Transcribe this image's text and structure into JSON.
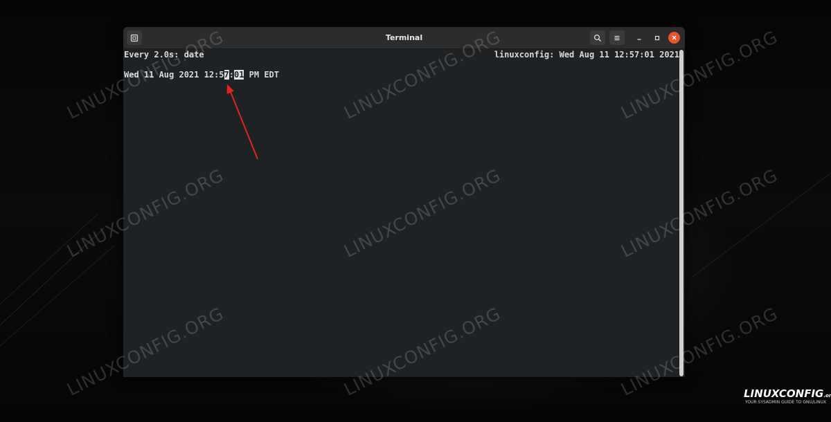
{
  "window": {
    "title": "Terminal",
    "icons": {
      "new_tab": "new-tab-icon",
      "search": "search-icon",
      "menu": "hamburger-menu-icon",
      "minimize": "minimize-icon",
      "maximize": "maximize-icon",
      "close": "close-icon"
    },
    "colors": {
      "titlebar": "#2c2c2c",
      "terminal_bg": "#1f2224",
      "close_button": "#e9542f"
    }
  },
  "terminal": {
    "header_left": "Every 2.0s: date",
    "header_right": "linuxconfig: Wed Aug 11 12:57:01 2021",
    "output_prefix": "Wed 11 Aug 2021 12:5",
    "output_hl1": "7",
    "output_sep": ":",
    "output_hl2": "01",
    "output_suffix": " PM EDT"
  },
  "annotation": {
    "arrow_color": "#e02424"
  },
  "watermark": {
    "text": "LINUXCONFIG.ORG"
  },
  "logo": {
    "main": "LINUXCONFIG",
    "suffix": ".org",
    "tagline": "YOUR SYSADMIN GUIDE TO GNU/LINUX"
  }
}
